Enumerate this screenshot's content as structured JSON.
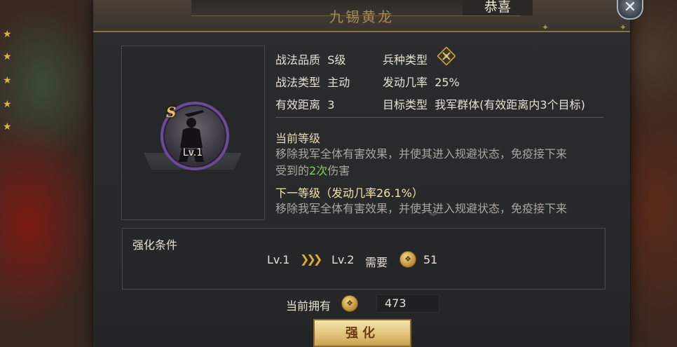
{
  "dialog": {
    "title": "九锡黄龙",
    "congrats": "恭喜",
    "close_glyph": "✕"
  },
  "skill": {
    "grade_badge": "S",
    "level_badge": "Lv.1",
    "attributes": [
      {
        "label": "战法品质",
        "value": "S级"
      },
      {
        "label": "兵种类型",
        "value": "",
        "icon": "troop-type-icon"
      },
      {
        "label": "战法类型",
        "value": "主动"
      },
      {
        "label": "发动几率",
        "value": "25%"
      },
      {
        "label": "有效距离",
        "value": "3"
      },
      {
        "label": "目标类型",
        "value": "我军群体(有效距离内3个目标)"
      }
    ]
  },
  "description": {
    "current_title": "当前等级",
    "current_line1": "移除我军全体有害效果，并使其进入规避状态，免疫接下来",
    "current_line2_pre": "受到的",
    "current_line2_highlight": "2次",
    "current_line2_post": "伤害",
    "next_title": "下一等级（发动几率26.1%）",
    "next_line1": "移除我军全体有害效果，并使其进入规避状态，免疫接下来"
  },
  "upgrade": {
    "condition_title": "强化条件",
    "from_level": "Lv.1",
    "to_level": "Lv.2",
    "need_label": "需要",
    "cost": "51",
    "owned_label": "当前拥有",
    "owned_value": "473",
    "button_label": "强化",
    "currency_icon": "skill-point-icon"
  },
  "colors": {
    "accent_gold": "#e0a83a",
    "highlight_green": "#7cd35a",
    "badge_purple": "#6c4a9a"
  }
}
